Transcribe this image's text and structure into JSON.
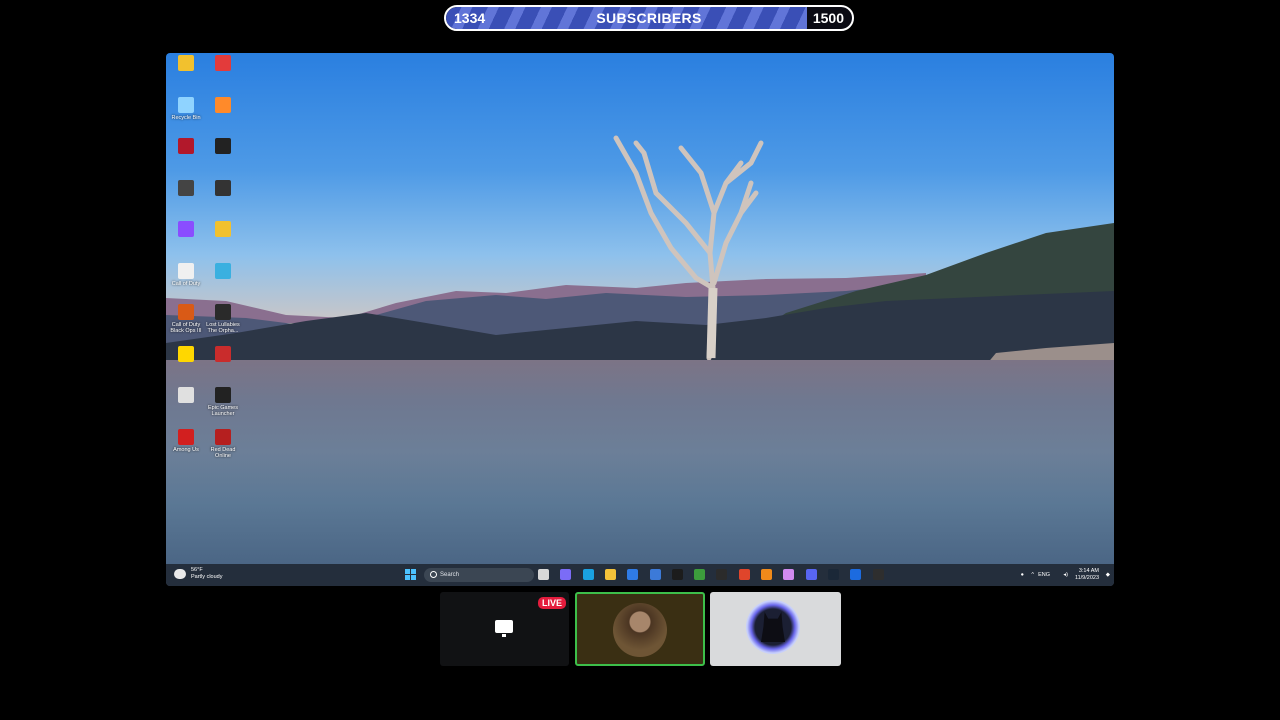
{
  "subscriber_goal": {
    "current": "1334",
    "label": "SUBSCRIBERS",
    "goal": "1500",
    "progress_fraction": 0.889,
    "fill_color": "#3a4fb6"
  },
  "desktop": {
    "icons": [
      {
        "label": "",
        "color": "#f2c12e"
      },
      {
        "label": "",
        "color": "#e33b3b"
      },
      {
        "label": "Recycle Bin",
        "color": "#8fd3ff"
      },
      {
        "label": "",
        "color": "#ff8a2a"
      },
      {
        "label": "",
        "color": "#b2182b"
      },
      {
        "label": "",
        "color": "#222222"
      },
      {
        "label": "",
        "color": "#444444"
      },
      {
        "label": "",
        "color": "#333333"
      },
      {
        "label": "",
        "color": "#8a4dff"
      },
      {
        "label": "",
        "color": "#f2c12e"
      },
      {
        "label": "Call of Duty",
        "color": "#f0f0f0"
      },
      {
        "label": "",
        "color": "#3ab0e0"
      },
      {
        "label": "Call of Duty Black Ops III",
        "color": "#d95a16"
      },
      {
        "label": "Lost Lullabies The Orpha...",
        "color": "#2a2a2a"
      },
      {
        "label": "",
        "color": "#ffd700"
      },
      {
        "label": "",
        "color": "#c92c2c"
      },
      {
        "label": "",
        "color": "#e0e0e0"
      },
      {
        "label": "Epic Games Launcher",
        "color": "#222222"
      },
      {
        "label": "Among Us",
        "color": "#d21f1f"
      },
      {
        "label": "Red Dead Online",
        "color": "#b51f1f"
      }
    ]
  },
  "taskbar": {
    "weather_temp": "56°F",
    "weather_desc": "Partly cloudy",
    "search_placeholder": "Search",
    "tray_lang": "ENG",
    "time": "3:14 AM",
    "date": "11/9/2023",
    "apps": [
      {
        "icon": "file-icon",
        "color": "#d8d8d8"
      },
      {
        "icon": "copilot-icon",
        "color": "#7b6cf6"
      },
      {
        "icon": "edge-icon",
        "color": "#1aa1e0"
      },
      {
        "icon": "folder-icon",
        "color": "#f3c23a"
      },
      {
        "icon": "store-icon",
        "color": "#2f7be6"
      },
      {
        "icon": "mail-icon",
        "color": "#3c7ad8"
      },
      {
        "icon": "app-icon",
        "color": "#1c1c1c"
      },
      {
        "icon": "chrome-icon",
        "color": "#3c9c3c"
      },
      {
        "icon": "terminal-icon",
        "color": "#2b2b2b"
      },
      {
        "icon": "brave-icon",
        "color": "#e0452b"
      },
      {
        "icon": "vlc-icon",
        "color": "#f08a1a"
      },
      {
        "icon": "app2-icon",
        "color": "#d18af0"
      },
      {
        "icon": "discord-icon",
        "color": "#5865f2"
      },
      {
        "icon": "steam-icon",
        "color": "#1b2838"
      },
      {
        "icon": "ps-icon",
        "color": "#1c6be0"
      },
      {
        "icon": "obs-icon",
        "color": "#2e2e2e"
      }
    ]
  },
  "cams": {
    "live_label": "LIVE"
  }
}
